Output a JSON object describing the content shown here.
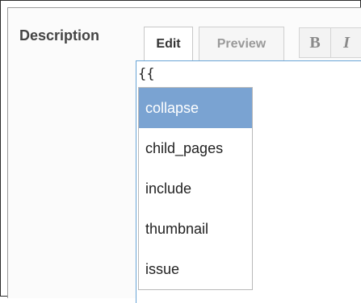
{
  "field": {
    "label": "Description"
  },
  "tabs": {
    "edit": "Edit",
    "preview": "Preview"
  },
  "toolbar": {
    "bold": "B",
    "italic": "I"
  },
  "editor": {
    "text": "{{"
  },
  "autocomplete": {
    "selected_index": 0,
    "items": [
      "collapse",
      "child_pages",
      "include",
      "thumbnail",
      "issue"
    ]
  }
}
